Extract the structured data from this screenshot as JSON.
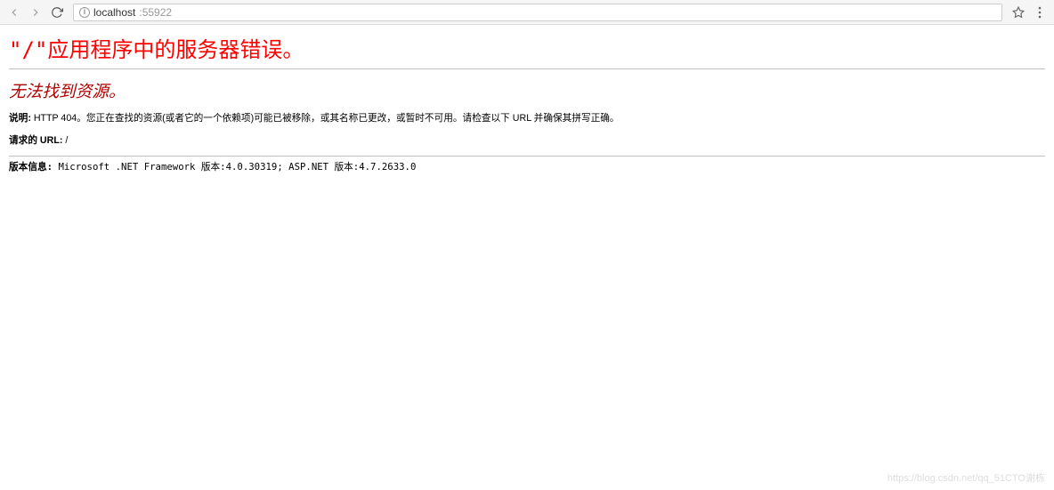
{
  "browser": {
    "url_host": "localhost",
    "url_port": ":55922"
  },
  "error": {
    "title": "\"/\"应用程序中的服务器错误。",
    "subtitle": "无法找到资源。",
    "description_label": "说明:",
    "description_text": " HTTP 404。您正在查找的资源(或者它的一个依赖项)可能已被移除，或其名称已更改，或暂时不可用。请检查以下 URL 并确保其拼写正确。",
    "requested_url_label": "请求的 URL:",
    "requested_url_value": " /",
    "version_label": "版本信息:",
    "version_text": " Microsoft .NET Framework 版本:4.0.30319; ASP.NET 版本:4.7.2633.0"
  },
  "watermark": "https://blog.csdn.net/qq_51CTO谢栋"
}
